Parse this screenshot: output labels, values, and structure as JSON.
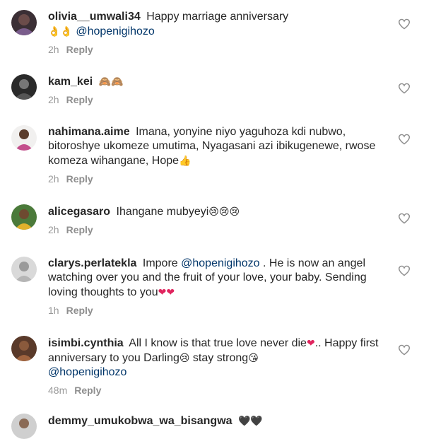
{
  "comments": [
    {
      "username": "olivia__umwali34",
      "text": "Happy marriage anniversary",
      "emojis": "👌👌",
      "mention": "@hopenigihozo",
      "time": "2h",
      "reply": "Reply",
      "avatar_icon": "avatar-olivia"
    },
    {
      "username": "kam_kei",
      "emojis": "🙈🙈",
      "time": "2h",
      "reply": "Reply",
      "avatar_icon": "avatar-kam"
    },
    {
      "username": "nahimana.aime",
      "text": "Imana, yonyine niyo yaguhoza kdi nubwo, bitoroshye ukomeze umutima, Nyagasani azi ibikugenewe, rwose komeza wihangane, Hope",
      "emojis": "👍",
      "time": "2h",
      "reply": "Reply",
      "avatar_icon": "avatar-nahimana"
    },
    {
      "username": "alicegasaro",
      "text": "Ihangane mubyeyi",
      "emojis": "😢😢😢",
      "time": "2h",
      "reply": "Reply",
      "avatar_icon": "avatar-alice"
    },
    {
      "username": "clarys.perlatekla",
      "text": "Impore",
      "mention": "@hopenigihozo",
      "text2": ". He is now an angel watching over you and the fruit of your love, your baby. Sending loving thoughts to you",
      "emojis": "❤❤",
      "time": "1h",
      "reply": "Reply",
      "avatar_icon": "avatar-clarys"
    },
    {
      "username": "isimbi.cynthia",
      "text": "All I know is that true love never die",
      "emoji_a": "❤",
      "text2": ".. Happy first anniversary to you Darling",
      "emoji_b": "😢",
      "text3": " stay strong",
      "emoji_c": "😘",
      "mention": "@hopenigihozo",
      "time": "48m",
      "reply": "Reply",
      "avatar_icon": "avatar-isimbi"
    },
    {
      "username": "demmy_umukobwa_wa_bisangwa",
      "emojis": "🖤🖤",
      "avatar_icon": "avatar-demmy"
    }
  ],
  "icons": {
    "like": "heart-outline-icon",
    "like_color": "#8e8e8e"
  },
  "colors": {
    "username": "#262626",
    "mention": "#003569",
    "meta": "#999999"
  }
}
